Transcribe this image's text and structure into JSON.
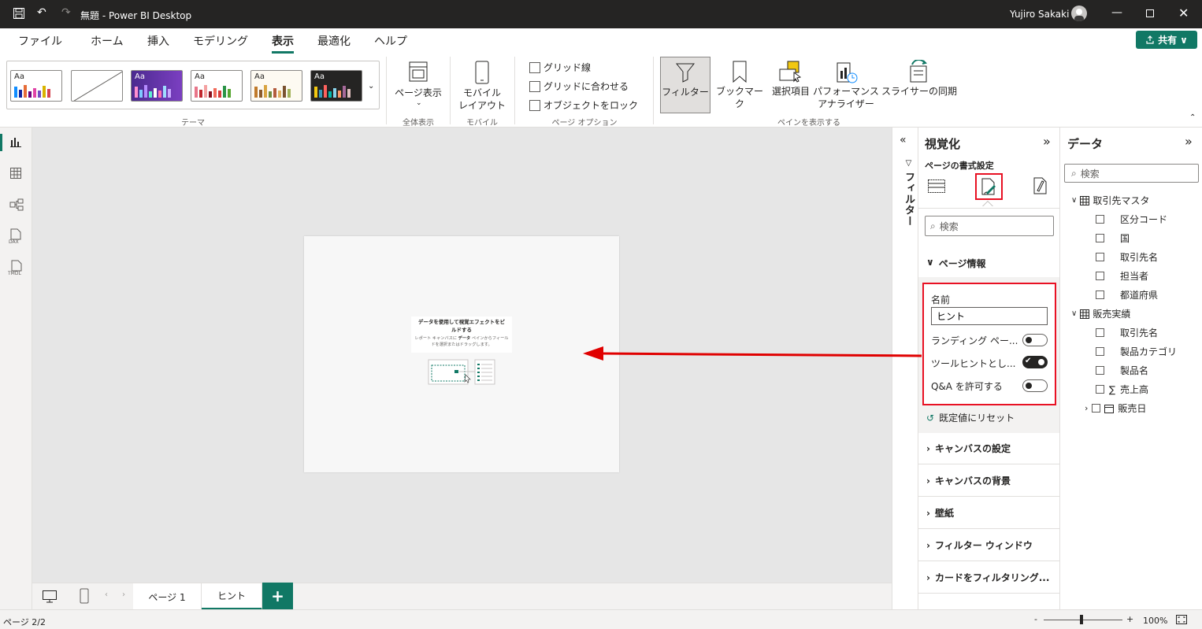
{
  "titlebar": {
    "title": "無題 - Power BI Desktop",
    "user": "Yujiro Sakaki"
  },
  "menu": [
    {
      "label": "ファイル"
    },
    {
      "label": "ホーム"
    },
    {
      "label": "挿入"
    },
    {
      "label": "モデリング"
    },
    {
      "label": "表示"
    },
    {
      "label": "最適化"
    },
    {
      "label": "ヘルプ"
    }
  ],
  "menu_active": "表示",
  "share_label": "共有",
  "ribbon": {
    "theme_label": "テーマ",
    "theme_aa": "Aa",
    "page_view_label": "ページ表示",
    "fit_label": "全体表示",
    "mobile_layout_label": "モバイル\nレイアウト",
    "mobile_label": "モバイル",
    "gridlines_label": "グリッド線",
    "snap_label": "グリッドに合わせる",
    "lock_label": "オブジェクトをロック",
    "page_options_label": "ページ オプション",
    "filter_label": "フィルター",
    "bookmark_label": "ブックマーク",
    "selection_label": "選択項目",
    "perf_label": "パフォーマンス\nアナライザー",
    "sync_label": "スライサーの同期",
    "show_panes_label": "ペインを表示する"
  },
  "canvas": {
    "hint_title": "データを使用して視覚エフェクトをビルドする",
    "hint_body_1": "レポート キャンバスに",
    "hint_body_bold": "データ",
    "hint_body_2": "ペインからフィールドを選択またはドラッグします。"
  },
  "filter_strip_label": "フィルター",
  "viz": {
    "title": "視覚化",
    "subtitle": "ページの書式設定",
    "search_placeholder": "検索",
    "page_info": "ページ情報",
    "name_label": "名前",
    "name_value": "ヒント",
    "landing_label": "ランディング ペー...",
    "landing_on": false,
    "tooltip_label": "ツールヒントとし...",
    "tooltip_on": true,
    "qa_label": "Q&A を許可する",
    "qa_on": false,
    "reset_label": "既定値にリセット",
    "sections": [
      "キャンバスの設定",
      "キャンバスの背景",
      "壁紙",
      "フィルター ウィンドウ",
      "カードをフィルタリング..."
    ]
  },
  "data": {
    "title": "データ",
    "search_placeholder": "検索",
    "tables": [
      {
        "name": "取引先マスタ",
        "fields": [
          "区分コード",
          "国",
          "取引先名",
          "担当者",
          "都道府県"
        ]
      },
      {
        "name": "販売実績",
        "fields": [
          "取引先名",
          "製品カテゴリ",
          "製品名",
          "売上高",
          "販売日"
        ]
      }
    ]
  },
  "tabs": [
    {
      "label": "ページ 1"
    },
    {
      "label": "ヒント"
    }
  ],
  "add_tab": "+",
  "status": {
    "page": "ページ 2/2",
    "zoom": "100%",
    "minus": "-",
    "plus": "+"
  },
  "colors": {
    "accent": "#117865",
    "highlight": "#e81123",
    "arrow": "#e00000"
  }
}
